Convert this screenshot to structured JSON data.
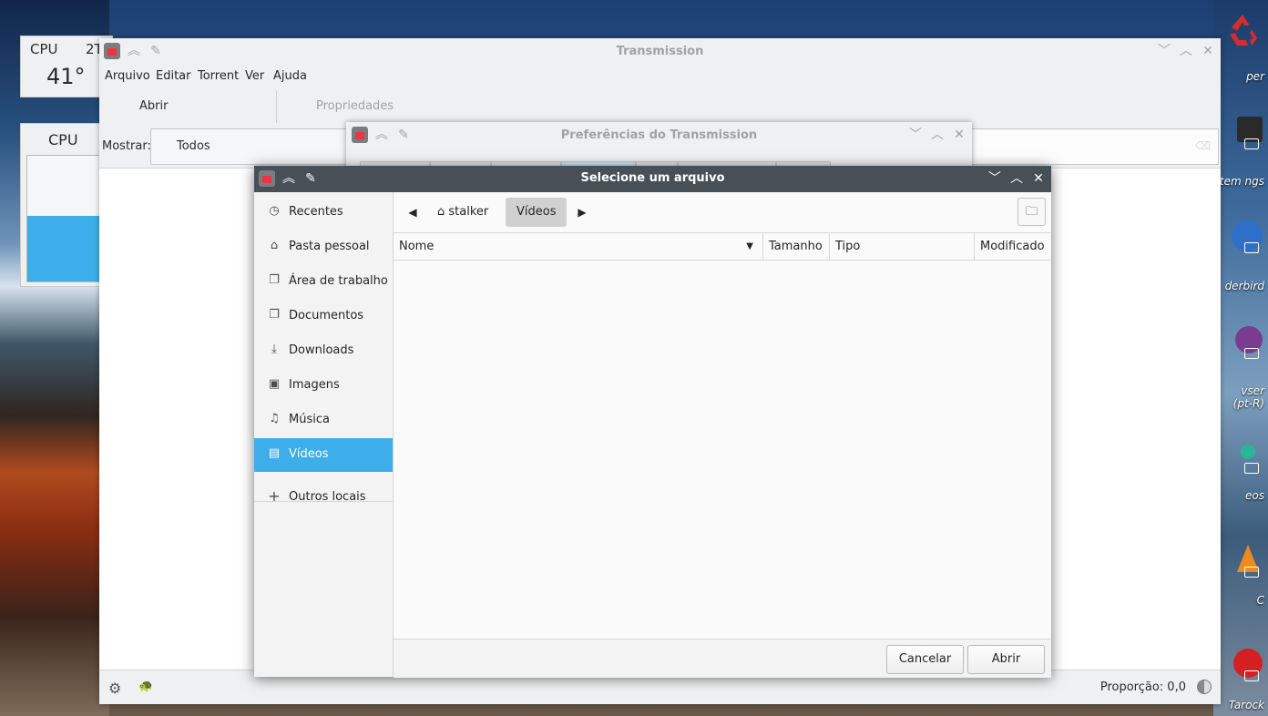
{
  "desktop": {
    "cpu_temp_widget": {
      "label": "CPU",
      "label2": "2T",
      "value": "41°"
    },
    "cpu_graph_widget": {
      "label": "CPU",
      "load_fraction": 0.52
    },
    "icon_labels": [
      "per",
      "tem ngs",
      "derbird",
      "vser (pt-R)",
      "eos",
      "C",
      "Tarock"
    ]
  },
  "main_window": {
    "title": "Transmission",
    "menu": [
      "Arquivo",
      "Editar",
      "Torrent",
      "Ver",
      "Ajuda"
    ],
    "toolbar": {
      "open_label": "Abrir",
      "properties_label": "Propriedades"
    },
    "filter": {
      "label": "Mostrar:",
      "value": "Todos"
    },
    "status": {
      "ratio_label": "Proporção: 0,0"
    }
  },
  "prefs_window": {
    "title": "Preferências do Transmission"
  },
  "file_dialog": {
    "title": "Selecione um arquivo",
    "sidebar": [
      {
        "icon": "clock-icon",
        "label": "Recentes"
      },
      {
        "icon": "home-icon",
        "label": "Pasta pessoal"
      },
      {
        "icon": "document-icon",
        "label": "Área de trabalho"
      },
      {
        "icon": "document-icon",
        "label": "Documentos"
      },
      {
        "icon": "download-icon",
        "label": "Downloads"
      },
      {
        "icon": "image-icon",
        "label": "Imagens"
      },
      {
        "icon": "music-icon",
        "label": "Música"
      },
      {
        "icon": "film-icon",
        "label": "Vídeos"
      }
    ],
    "other_locations": "Outros locais",
    "path": {
      "home": "stalker",
      "current": "Vídeos"
    },
    "columns": {
      "name": "Nome",
      "size": "Tamanho",
      "type": "Tipo",
      "modified": "Modificado"
    },
    "buttons": {
      "cancel": "Cancelar",
      "open": "Abrir"
    },
    "accent_color": "#3daee9"
  }
}
